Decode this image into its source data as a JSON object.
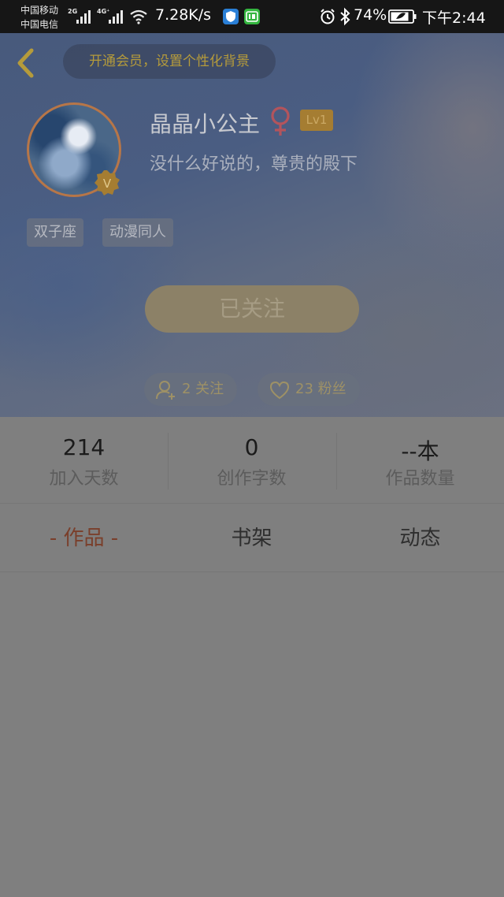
{
  "status_bar": {
    "carrier_1": "中国移动",
    "carrier_2": "中国电信",
    "net_type_1": "2G",
    "net_type_2": "4G⁺",
    "speed": "7.28K/s",
    "battery_percent": "74%",
    "time": "下午2:44"
  },
  "header": {
    "vip_prompt": "开通会员，设置个性化背景",
    "username": "晶晶小公主",
    "level": "Lv1",
    "bio": "没什么好说的，尊贵的殿下",
    "tags": [
      "双子座",
      "动漫同人"
    ],
    "follow_button": "已关注",
    "following": "2 关注",
    "fans": "23 粉丝"
  },
  "stats": [
    {
      "value": "214",
      "label": "加入天数"
    },
    {
      "value": "0",
      "label": "创作字数"
    },
    {
      "value": "--本",
      "label": "作品数量"
    }
  ],
  "tabs": [
    {
      "label": "- 作品 -",
      "active": true
    },
    {
      "label": "书架",
      "active": false
    },
    {
      "label": "动态",
      "active": false
    }
  ],
  "colors": {
    "accent": "#b59b3b",
    "active_tab": "#7a3f2b",
    "overlay_gray": "#7f7f7f",
    "female_symbol": "#b3545c"
  }
}
